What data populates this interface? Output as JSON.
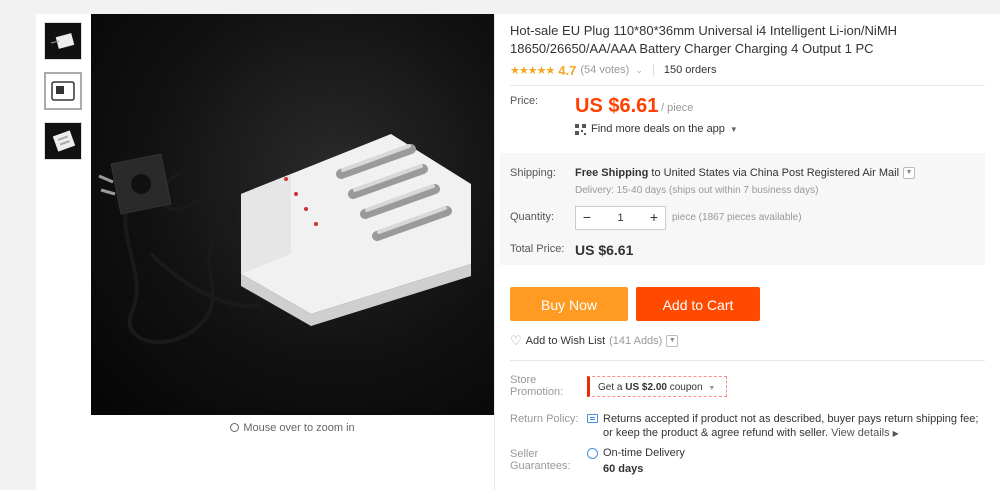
{
  "product": {
    "title": "Hot-sale EU Plug 110*80*36mm Universal i4 Intelligent Li-ion/NiMH 18650/26650/AA/AAA Battery Charger Charging 4 Output 1 PC",
    "rating": "4.7",
    "stars": "★★★★★",
    "votes": "(54 votes)",
    "orders": "150 orders"
  },
  "gallery": {
    "zoom_hint": "Mouse over to zoom in"
  },
  "price": {
    "label": "Price:",
    "value": "US $6.61",
    "unit": "/ piece",
    "deals": "Find more deals on the app"
  },
  "shipping": {
    "label": "Shipping:",
    "free": "Free Shipping",
    "destination": " to United States via China Post Registered Air Mail",
    "delivery": "Delivery: 15-40 days (ships out within 7 business days)"
  },
  "quantity": {
    "label": "Quantity:",
    "minus": "−",
    "value": "1",
    "plus": "+",
    "available": "piece (1867 pieces available)"
  },
  "total": {
    "label": "Total Price:",
    "value": "US $6.61"
  },
  "actions": {
    "buy_now": "Buy Now",
    "add_to_cart": "Add to Cart",
    "wish_list": "Add to Wish List",
    "wish_adds": "(141 Adds)"
  },
  "store_promotion": {
    "label_line1": "Store",
    "label_line2": "Promotion:",
    "coupon_prefix": "Get a ",
    "coupon_amount": "US $2.00",
    "coupon_suffix": " coupon"
  },
  "return_policy": {
    "label": "Return Policy:",
    "text": "Returns accepted if product not as described, buyer pays return shipping fee; or keep the product & agree refund with seller.",
    "link": "View details"
  },
  "guarantees": {
    "label_line1": "Seller",
    "label_line2": "Guarantees:",
    "line1": "On-time Delivery",
    "line2": "60 days"
  },
  "colors": {
    "price": "#ff4000",
    "buy_now": "#ff9a23",
    "add_to_cart": "#ff4a00",
    "rating": "#f5a623"
  }
}
